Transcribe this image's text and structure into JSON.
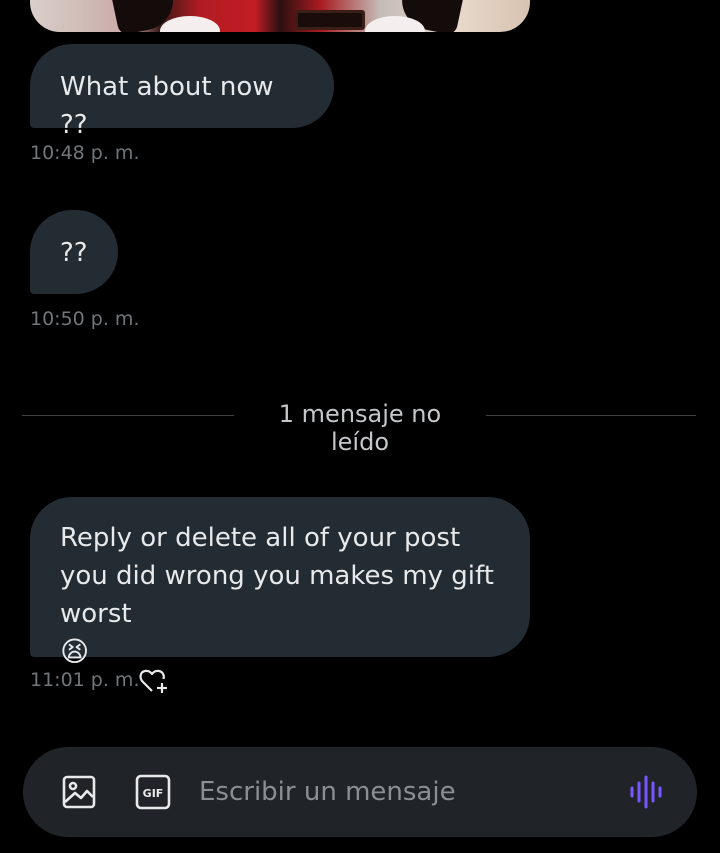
{
  "messages": [
    {
      "text": "What about now ??",
      "time": "10:48 p. m."
    },
    {
      "text": "??",
      "time": "10:50 p. m."
    },
    {
      "text": "Reply or delete all of your post you did wrong you makes my gift worst",
      "emoji": "😫",
      "time": "11:01 p. m."
    }
  ],
  "unread_divider": "1 mensaje no leído",
  "composer": {
    "placeholder": "Escribir un mensaje",
    "gif_label": "GIF",
    "icons": [
      "image-icon",
      "gif-icon",
      "voice-wave-icon",
      "heart-plus-icon"
    ]
  },
  "colors": {
    "background": "#000000",
    "bubble": "#232b33",
    "timestamp": "#71767b",
    "voice_accent": "#7856ff"
  }
}
